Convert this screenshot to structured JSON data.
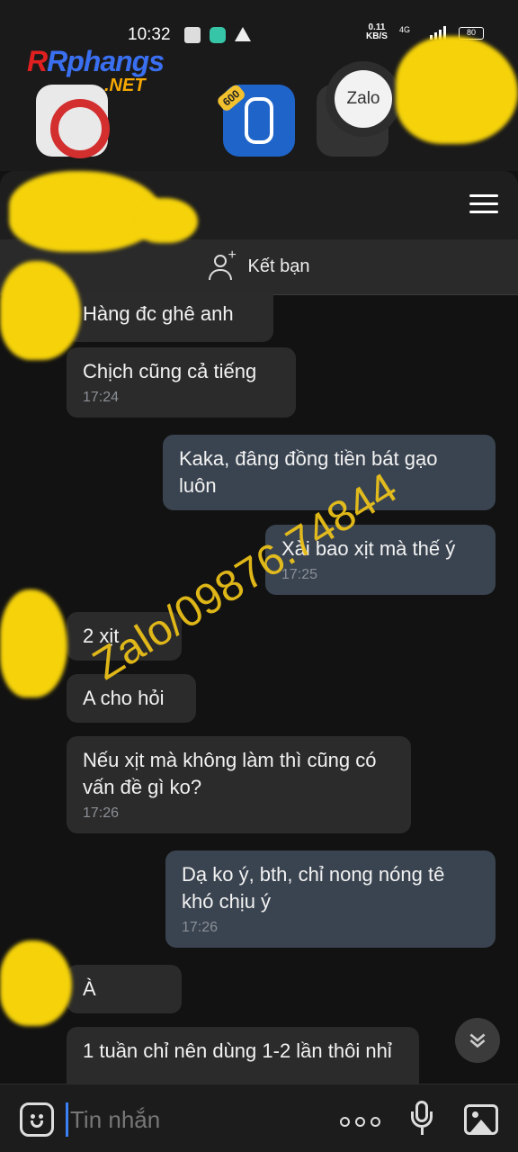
{
  "status_bar": {
    "time": "10:32",
    "net_speed_value": "0.11",
    "net_speed_unit": "KB/S",
    "network": "4G",
    "battery": "80"
  },
  "watermark_logo": {
    "name": "Rphangs",
    "domain": ".NET"
  },
  "launcher": {
    "traffic_badge": "600",
    "zalo_label": "Zalo"
  },
  "chat": {
    "add_friend_label": "Kết bạn",
    "messages": [
      {
        "dir": "in",
        "text": "Hàng đc ghê anh",
        "time": ""
      },
      {
        "dir": "in",
        "text": "Chịch cũng cả tiếng",
        "time": "17:24"
      },
      {
        "dir": "out",
        "text": "Kaka, đâng đồng tiền bát gạo luôn",
        "time": ""
      },
      {
        "dir": "out",
        "text": "Xài bao xịt mà thế ý",
        "time": "17:25"
      },
      {
        "dir": "in",
        "text": "2 xịt",
        "time": ""
      },
      {
        "dir": "in",
        "text": "A cho hỏi",
        "time": ""
      },
      {
        "dir": "in",
        "text": "Nếu xịt mà không làm thì cũng có vấn đề gì ko?",
        "time": "17:26"
      },
      {
        "dir": "out",
        "text": "Dạ ko ý, bth, chỉ nong nóng tê khó chịu ý",
        "time": "17:26"
      },
      {
        "dir": "in",
        "text": "À",
        "time": ""
      },
      {
        "dir": "in",
        "text": "1 tuần chỉ nên dùng 1-2 lần thôi nhỉ",
        "time": ""
      }
    ]
  },
  "overlay_watermark": "Zalo/09876.74844",
  "input": {
    "placeholder": "Tin nhắn"
  },
  "colors": {
    "background": "#121212",
    "incoming_bubble": "#2b2b2b",
    "outgoing_bubble": "#3a4450",
    "watermark": "#f0c419",
    "cursor": "#3b82f6"
  }
}
